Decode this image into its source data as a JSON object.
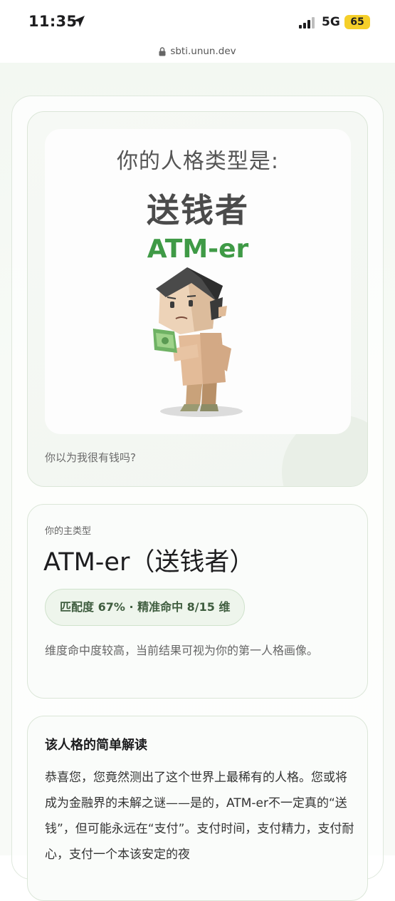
{
  "status_bar": {
    "time": "11:35",
    "network": "5G",
    "battery": "65"
  },
  "browser": {
    "url": "sbti.unun.dev"
  },
  "hero": {
    "heading": "你的人格类型是:",
    "name": "送钱者",
    "name_en": "ATM-er",
    "caption": "你以为我很有钱吗?"
  },
  "type_card": {
    "label": "你的主类型",
    "main_type": "ATM-er（送钱者）",
    "match": "匹配度 67% · 精准命中 8/15 维",
    "description": "维度命中度较高，当前结果可视为你的第一人格画像。"
  },
  "interpretation": {
    "title": "该人格的简单解读",
    "body": "恭喜您，您竟然测出了这个世界上最稀有的人格。您或将成为金融界的未解之谜——是的，ATM-er不一定真的“送钱”，但可能永远在“支付”。支付时间，支付精力，支付耐心，支付一个本该安定的夜"
  },
  "colors": {
    "accent_green": "#3f9a46",
    "card_border": "#dbe6d8",
    "pill_bg": "#eef5ec"
  }
}
